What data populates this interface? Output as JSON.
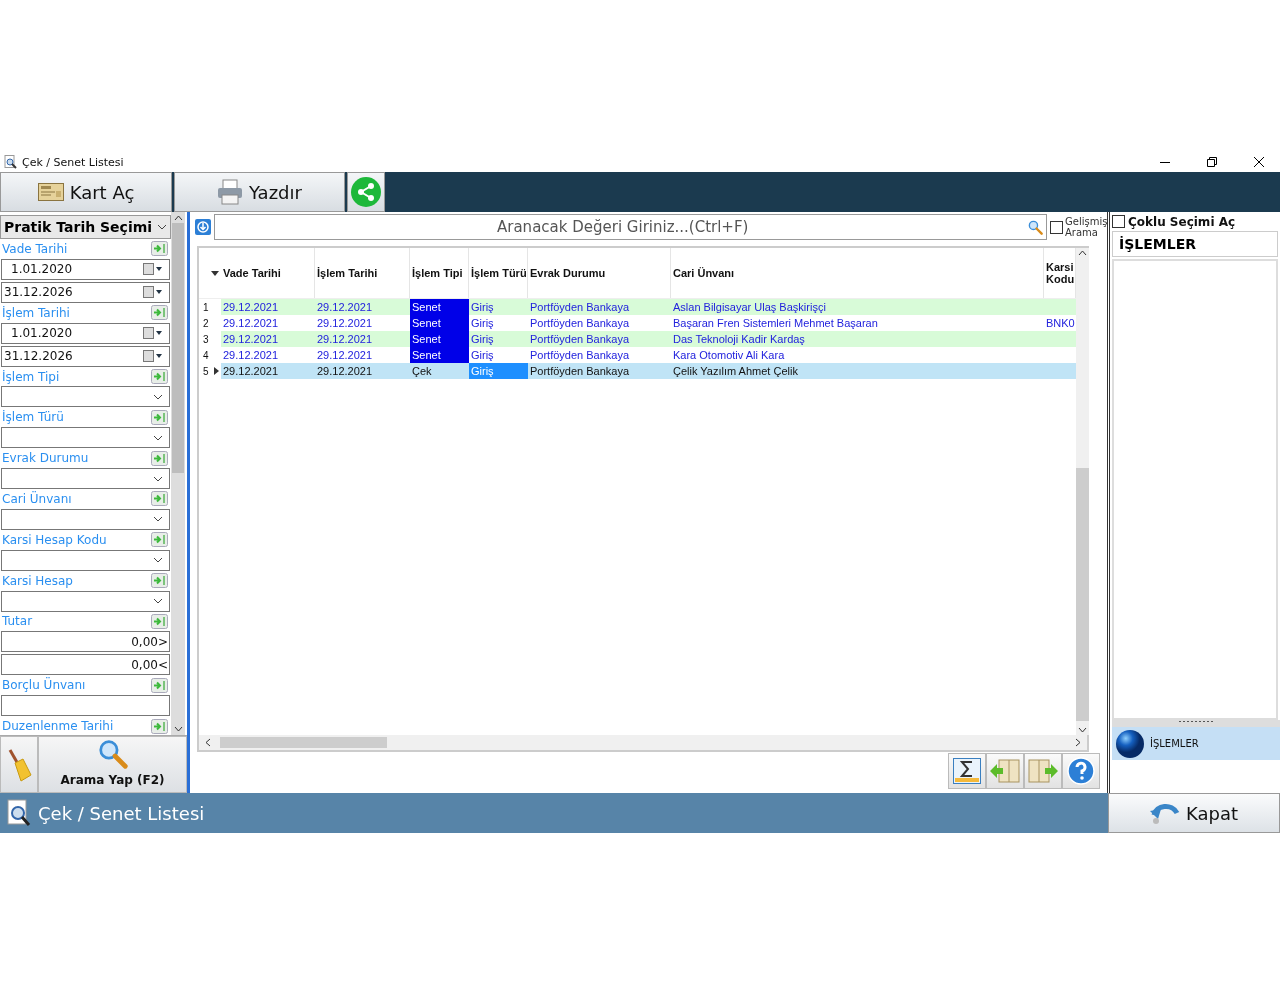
{
  "window": {
    "title": "Çek / Senet Listesi"
  },
  "toolbar": {
    "buttons": [
      {
        "kind": "card",
        "label": "Kart Aç"
      },
      {
        "kind": "print",
        "label": "Yazdır"
      },
      {
        "kind": "share"
      }
    ]
  },
  "filters": {
    "preset": "Pratik Tarih Seçimi",
    "groups": [
      {
        "label": "Vade Tarihi",
        "fields": [
          {
            "kind": "date",
            "value": "1.01.2020",
            "indented": true
          },
          {
            "kind": "date",
            "value": "31.12.2026",
            "indented": false
          }
        ]
      },
      {
        "label": "İşlem Tarihi",
        "fields": [
          {
            "kind": "date",
            "value": "1.01.2020",
            "indented": true
          },
          {
            "kind": "date",
            "value": "31.12.2026",
            "indented": false
          }
        ]
      },
      {
        "label": "İşlem Tipi",
        "fields": [
          {
            "kind": "combo"
          }
        ]
      },
      {
        "label": "İşlem Türü",
        "fields": [
          {
            "kind": "combo"
          }
        ]
      },
      {
        "label": "Evrak Durumu",
        "fields": [
          {
            "kind": "combo"
          }
        ]
      },
      {
        "label": "Cari Ünvanı",
        "fields": [
          {
            "kind": "combo"
          }
        ]
      },
      {
        "label": "Karsi Hesap Kodu",
        "fields": [
          {
            "kind": "combo"
          }
        ]
      },
      {
        "label": "Karsi Hesap",
        "fields": [
          {
            "kind": "combo"
          }
        ]
      },
      {
        "label": "Tutar",
        "fields": [
          {
            "kind": "number",
            "value": "0,00>"
          },
          {
            "kind": "number",
            "value": "0,00<"
          }
        ]
      },
      {
        "label": "Borçlu Ünvanı",
        "fields": [
          {
            "kind": "text"
          }
        ]
      },
      {
        "label": "Duzenlenme Tarihi"
      }
    ],
    "search_button": "Arama Yap (F2)"
  },
  "search": {
    "placeholder": "Aranacak Değeri Giriniz...(Ctrl+F)",
    "advanced_label": "Gelişmiş Arama",
    "advanced_checked": false
  },
  "grid": {
    "columns": [
      {
        "label": "Vade Tarihi",
        "focused": false
      },
      {
        "label": "İşlem Tarihi",
        "focused": false
      },
      {
        "label": "İşlem Tipi",
        "focused": false
      },
      {
        "label": "İşlem Türü",
        "focused": true
      },
      {
        "label": "Evrak Durumu",
        "focused": false
      },
      {
        "label": "Cari Ünvanı",
        "focused": false
      },
      {
        "label": "Karsi Kodu",
        "focused": false
      }
    ],
    "rows": [
      {
        "number": "1",
        "selected": false,
        "type_highlighted": true,
        "cells": [
          "29.12.2021",
          "29.12.2021",
          "Senet",
          "Giriş",
          "Portföyden Bankaya",
          "Aslan Bilgisayar Ulaş Başkirişçi",
          null
        ]
      },
      {
        "number": "2",
        "selected": false,
        "type_highlighted": true,
        "cells": [
          "29.12.2021",
          "29.12.2021",
          "Senet",
          "Giriş",
          "Portföyden Bankaya",
          "Başaran Fren Sistemleri Mehmet Başaran",
          "BNK0"
        ]
      },
      {
        "number": "3",
        "selected": false,
        "type_highlighted": true,
        "cells": [
          "29.12.2021",
          "29.12.2021",
          "Senet",
          "Giriş",
          "Portföyden Bankaya",
          "Das Teknoloji Kadir Kardaş",
          null
        ]
      },
      {
        "number": "4",
        "selected": false,
        "type_highlighted": true,
        "cells": [
          "29.12.2021",
          "29.12.2021",
          "Senet",
          "Giriş",
          "Portföyden Bankaya",
          "Kara Otomotiv Ali Kara",
          null
        ]
      },
      {
        "number": "5",
        "selected": true,
        "type_highlighted": false,
        "cells": [
          "29.12.2021",
          "29.12.2021",
          "Çek",
          "Giriş",
          "Portföyden Bankaya",
          "Çelik Yazılım Ahmet Çelik",
          null
        ]
      }
    ]
  },
  "grid_tools": [
    {
      "kind": "sum"
    },
    {
      "kind": "prev"
    },
    {
      "kind": "next"
    },
    {
      "kind": "help"
    }
  ],
  "side": {
    "multi_select_label": "Çoklu Seçimi Aç",
    "multi_select_checked": false,
    "header": "İŞLEMLER",
    "nav": [
      {
        "label": "İŞLEMLER",
        "selected": true
      }
    ]
  },
  "status_bar": {
    "title": "Çek / Senet Listesi",
    "close_button": "Kapat"
  }
}
